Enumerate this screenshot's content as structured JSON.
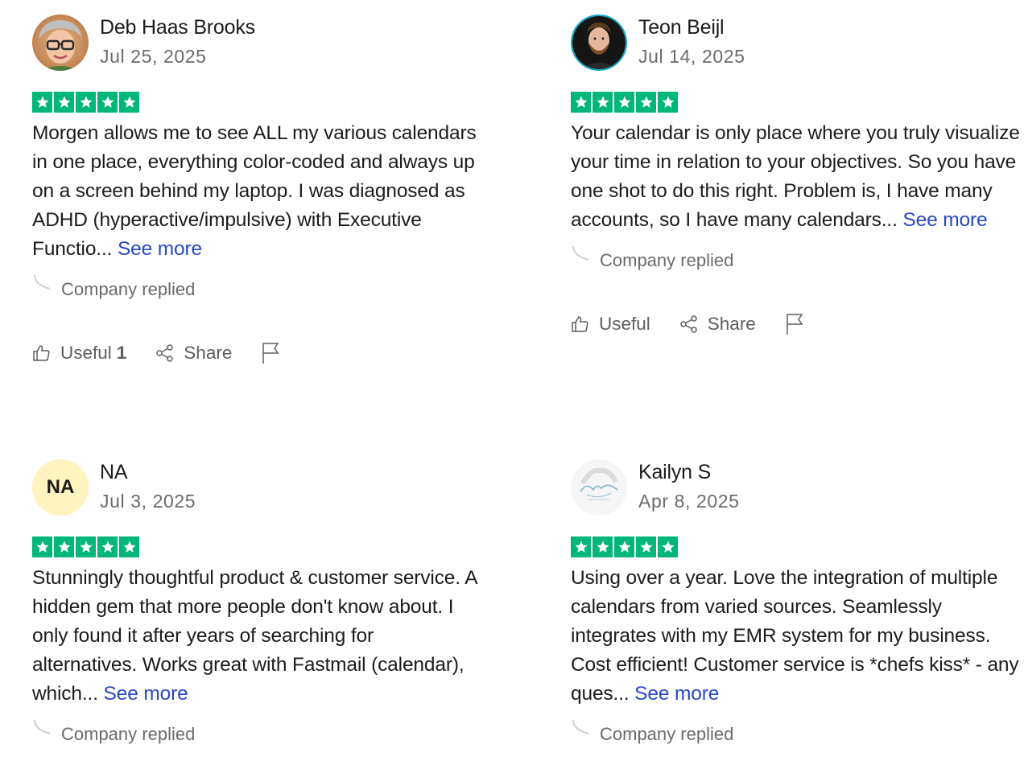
{
  "reviews": [
    {
      "name": "Deb Haas Brooks",
      "date": "Jul 25, 2025",
      "rating": 5,
      "text": "Morgen allows me to see ALL my various calendars in one place, everything color-coded and always up on a screen behind my laptop. I was diagnosed as ADHD (hyperactive/impulsive) with Executive Functio...",
      "see_more": "See more",
      "company_replied": "Company replied",
      "useful_label": "Useful",
      "useful_count": "1",
      "share_label": "Share"
    },
    {
      "name": "Teon Beijl",
      "date": "Jul 14, 2025",
      "rating": 5,
      "text": "Your calendar is only place where you truly visualize your time in relation to your objectives. So you have one shot to do this right. Problem is, I have many accounts, so I have many calendars...",
      "see_more": "See more",
      "company_replied": "Company replied",
      "useful_label": "Useful",
      "share_label": "Share"
    },
    {
      "name": "NA",
      "initials": "NA",
      "date": "Jul 3, 2025",
      "rating": 5,
      "text": "Stunningly thoughtful product & customer service. A hidden gem that more people don't know about. I only found it after years of searching for alternatives. Works great with Fastmail (calendar), which...",
      "see_more": "See more",
      "company_replied": "Company replied"
    },
    {
      "name": "Kailyn S",
      "date": "Apr 8, 2025",
      "rating": 5,
      "text": "Using over a year. Love the integration of multiple calendars from varied sources. Seamlessly integrates with my EMR system for my business. Cost efficient! Customer service is *chefs kiss* - any ques...",
      "see_more": "See more",
      "company_replied": "Company replied"
    }
  ],
  "colors": {
    "star_green": "#00b67a",
    "link_blue": "#2848c5",
    "muted_text": "#6b6b6b",
    "initials_avatar_bg": "#fff3bf"
  },
  "icons": {
    "star": "star-icon",
    "thumbs_up": "thumbs-up-icon",
    "share": "share-icon",
    "flag": "flag-icon",
    "reply": "reply-curve-icon"
  }
}
